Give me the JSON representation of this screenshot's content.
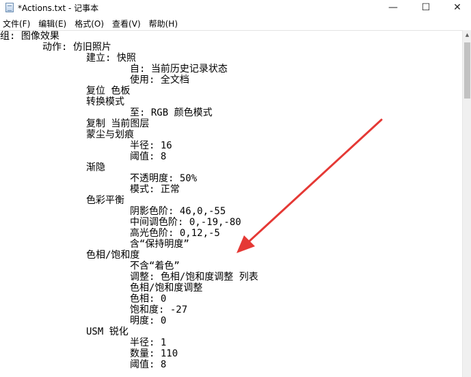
{
  "window": {
    "title": "*Actions.txt - 记事本",
    "icon": "notepad-icon",
    "controls": {
      "minimize": "—",
      "maximize": "☐",
      "close": "✕"
    }
  },
  "menu": {
    "file": "文件(F)",
    "edit": "编辑(E)",
    "format": "格式(O)",
    "view": "查看(V)",
    "help": "帮助(H)"
  },
  "editor": {
    "lines": [
      "组: 图像效果",
      "动作: 仿旧照片",
      "建立: 快照",
      "自: 当前历史记录状态",
      "使用: 全文档",
      "复位 色板",
      "转换模式",
      "至: RGB 颜色模式",
      "复制 当前图层",
      "蒙尘与划痕",
      "半径: 16",
      "阈值: 8",
      "渐隐",
      "不透明度: 50%",
      "模式: 正常",
      "色彩平衡",
      "阴影色阶: 46,0,-55",
      "中间调色阶: 0,-19,-80",
      "高光色阶: 0,12,-5",
      "含“保持明度”",
      "色相/饱和度",
      "不含“着色”",
      "调整: 色相/饱和度调整 列表",
      "色相/饱和度调整",
      "色相: 0",
      "饱和度: -27",
      "明度: 0",
      "USM 锐化",
      "半径: 1",
      "数量: 110",
      "阈值: 8"
    ]
  },
  "annotation": {
    "arrow_color": "#e53935"
  }
}
